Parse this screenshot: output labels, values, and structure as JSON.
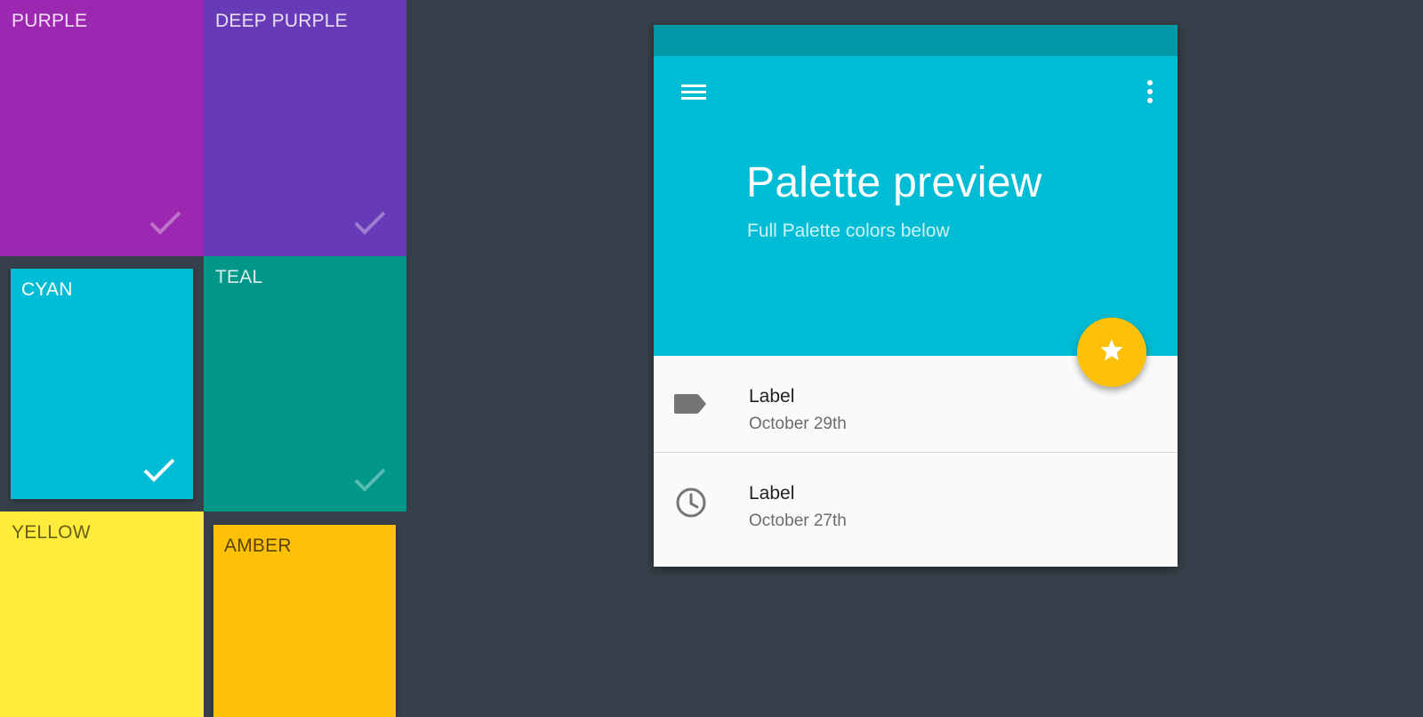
{
  "colors": {
    "background": "#37404a",
    "cyan_primary": "#00bcd4",
    "cyan_dark": "#0097a7",
    "amber_accent": "#ffc107",
    "list_icon": "#757575"
  },
  "palette": {
    "tiles": [
      {
        "name": "PURPLE",
        "color": "#9c27b0",
        "selected": false
      },
      {
        "name": "DEEP PURPLE",
        "color": "#673ab7",
        "selected": false
      },
      {
        "name": "CYAN",
        "color": "#00bcd4",
        "selected": true
      },
      {
        "name": "TEAL",
        "color": "#009688",
        "selected": false
      },
      {
        "name": "YELLOW",
        "color": "#ffeb3b",
        "selected": false
      },
      {
        "name": "AMBER",
        "color": "#ffc107",
        "selected": false
      }
    ]
  },
  "preview": {
    "title": "Palette preview",
    "subtitle": "Full Palette colors below",
    "menu_icon": "menu-icon",
    "more_icon": "more-vert-icon",
    "fab_icon": "star-icon",
    "list": [
      {
        "icon": "label-icon",
        "label": "Label",
        "date": "October 29th"
      },
      {
        "icon": "clock-icon",
        "label": "Label",
        "date": "October 27th"
      }
    ]
  }
}
